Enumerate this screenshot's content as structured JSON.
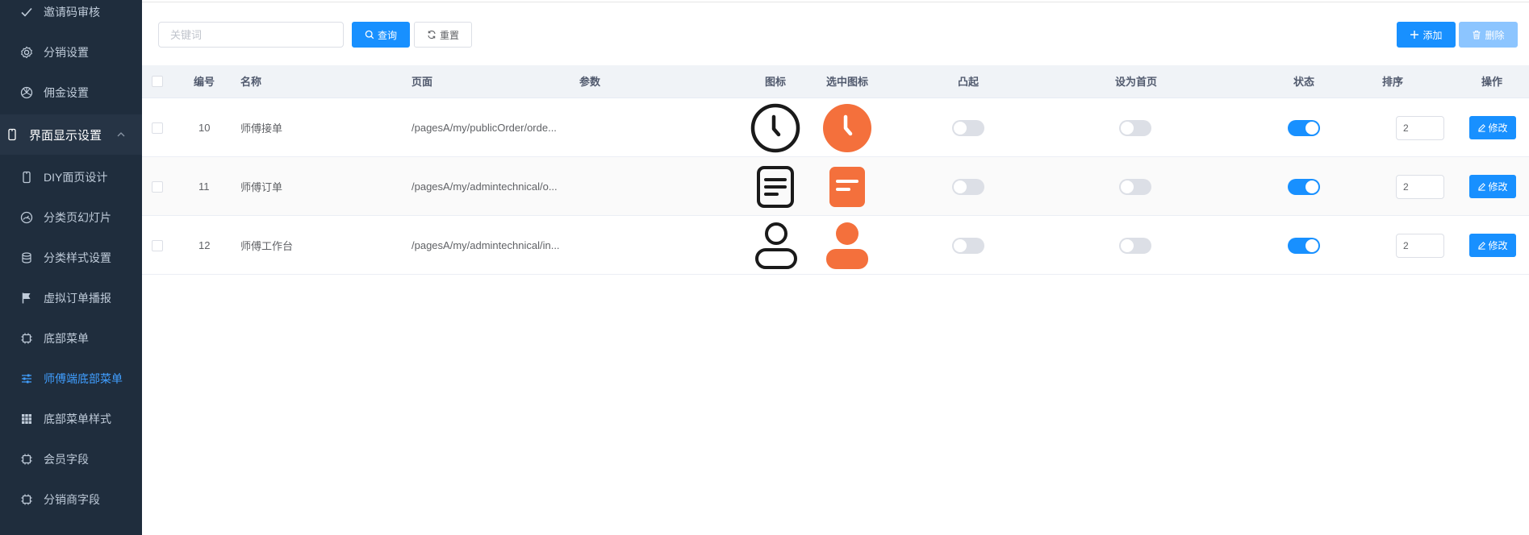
{
  "sidebar": {
    "items": [
      {
        "label": "邀请码审核",
        "icon": "check-icon"
      },
      {
        "label": "分销设置",
        "icon": "gear-icon"
      },
      {
        "label": "佣金设置",
        "icon": "aperture-icon"
      },
      {
        "label": "界面显示设置",
        "icon": "phone-icon",
        "group": true
      },
      {
        "label": "DIY面页设计",
        "icon": "phone-icon"
      },
      {
        "label": "分类页幻灯片",
        "icon": "gauge-icon"
      },
      {
        "label": "分类样式设置",
        "icon": "coins-icon"
      },
      {
        "label": "虚拟订单播报",
        "icon": "flag-icon"
      },
      {
        "label": "底部菜单",
        "icon": "chip-icon"
      },
      {
        "label": "师傅端底部菜单",
        "icon": "sliders-icon",
        "active": true
      },
      {
        "label": "底部菜单样式",
        "icon": "grid-icon"
      },
      {
        "label": "会员字段",
        "icon": "chip-icon"
      },
      {
        "label": "分销商字段",
        "icon": "chip-icon"
      }
    ]
  },
  "toolbar": {
    "search_placeholder": "关键词",
    "search_value": "",
    "query_label": "查询",
    "reset_label": "重置",
    "add_label": "添加",
    "delete_label": "删除"
  },
  "table": {
    "headers": {
      "id": "编号",
      "name": "名称",
      "page": "页面",
      "params": "参数",
      "icon": "图标",
      "selected_icon": "选中图标",
      "raised": "凸起",
      "homepage": "设为首页",
      "status": "状态",
      "sort": "排序",
      "action": "操作"
    },
    "edit_label": "修改",
    "rows": [
      {
        "id": "10",
        "name": "师傅接单",
        "page": "/pagesA/my/publicOrder/orde...",
        "params": "",
        "icon": "clock-icon",
        "raised": false,
        "homepage": false,
        "status": true,
        "sort": "2"
      },
      {
        "id": "11",
        "name": "师傅订单",
        "page": "/pagesA/my/admintechnical/o...",
        "params": "",
        "icon": "document-icon",
        "raised": false,
        "homepage": false,
        "status": true,
        "sort": "2"
      },
      {
        "id": "12",
        "name": "师傅工作台",
        "page": "/pagesA/my/admintechnical/in...",
        "params": "",
        "icon": "user-icon",
        "raised": false,
        "homepage": false,
        "status": true,
        "sort": "2"
      }
    ]
  },
  "colors": {
    "sidebar_bg": "#1f2d3d",
    "primary": "#1890ff",
    "selected_icon": "#f4703c",
    "active_menu": "#409eff"
  }
}
